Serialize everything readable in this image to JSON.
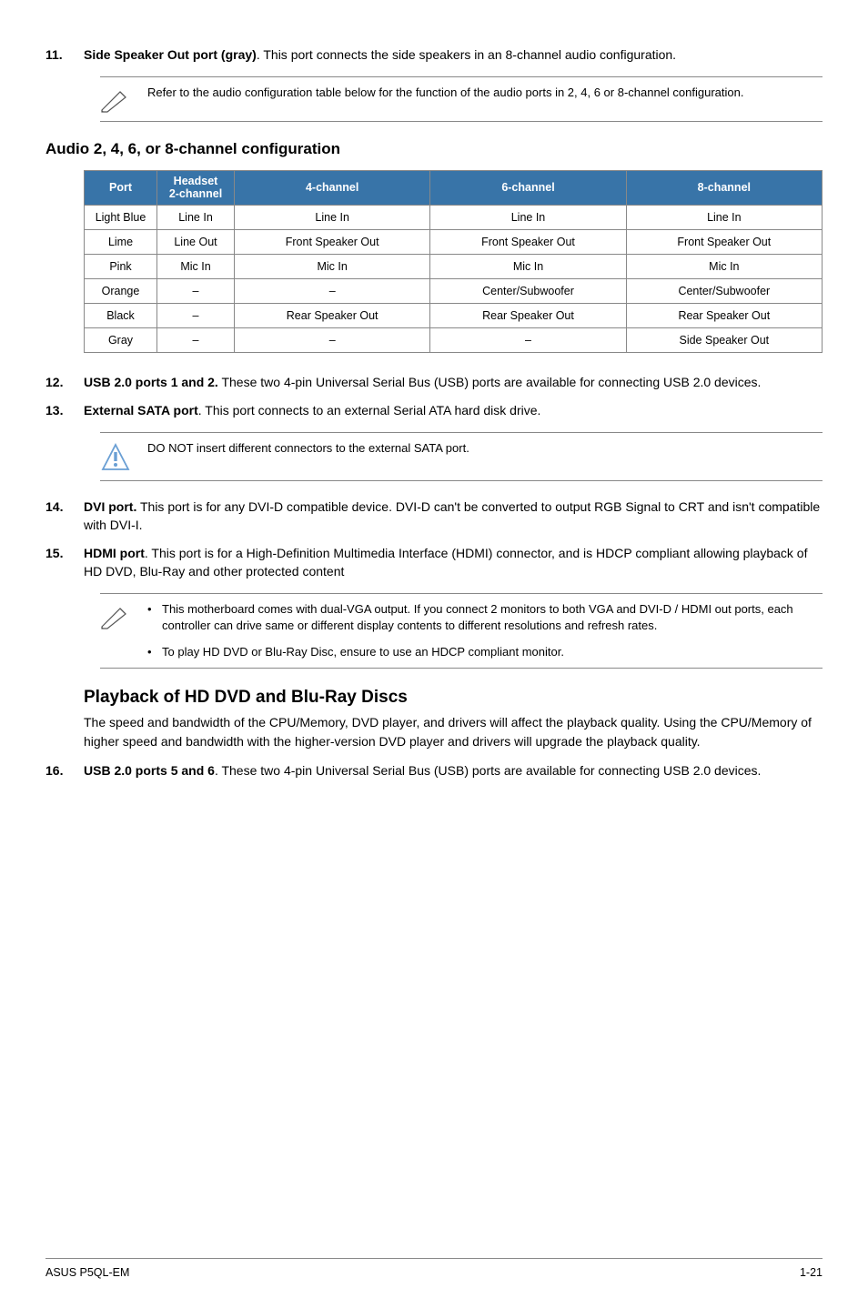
{
  "items": {
    "i11": {
      "num": "11.",
      "title": "Side Speaker Out port (gray)",
      "text": ". This port connects the side speakers in an 8-channel audio configuration."
    },
    "i12": {
      "num": "12.",
      "title": "USB 2.0 ports 1 and 2.",
      "text": " These two 4-pin Universal Serial Bus (USB) ports are available for connecting USB 2.0 devices."
    },
    "i13": {
      "num": "13.",
      "title": "External SATA port",
      "text": ". This port connects to an external Serial ATA hard disk drive."
    },
    "i14": {
      "num": "14.",
      "title": "DVI port.",
      "text": " This port is for any DVI-D compatible device. DVI-D can't be converted to output RGB  Signal to CRT and isn't compatible with DVI-I."
    },
    "i15": {
      "num": "15.",
      "title": "HDMI port",
      "text": ". This port is for a High-Definition Multimedia Interface (HDMI) connector, and is HDCP compliant allowing playback of HD DVD, Blu-Ray and other protected content"
    },
    "i16": {
      "num": "16.",
      "title": "USB 2.0 ports 5 and 6",
      "text": ". These two 4-pin Universal Serial Bus (USB) ports are available for connecting USB 2.0 devices."
    }
  },
  "notes": {
    "n1": "Refer to the audio configuration table below for the function of the audio ports in 2, 4, 6 or 8-channel configuration.",
    "n2": "DO NOT insert different connectors to the external SATA port.",
    "n3a": "This motherboard comes with dual-VGA output. If you connect 2 monitors to both VGA and DVI-D / HDMI out ports, each controller can drive same or different display contents to different resolutions and refresh rates.",
    "n3b": "To play HD DVD or Blu-Ray Disc, ensure to use an HDCP compliant monitor."
  },
  "table_heading": "Audio 2, 4, 6, or 8-channel configuration",
  "table": {
    "headers": {
      "port": "Port",
      "headset_l1": "Headset",
      "headset_l2": "2-channel",
      "c4": "4-channel",
      "c6": "6-channel",
      "c8": "8-channel"
    },
    "rows": [
      {
        "port": "Light Blue",
        "h": "Line In",
        "c4": "Line In",
        "c6": "Line In",
        "c8": "Line In"
      },
      {
        "port": "Lime",
        "h": "Line Out",
        "c4": "Front Speaker Out",
        "c6": "Front Speaker Out",
        "c8": "Front Speaker Out"
      },
      {
        "port": "Pink",
        "h": "Mic In",
        "c4": "Mic In",
        "c6": "Mic In",
        "c8": "Mic In"
      },
      {
        "port": "Orange",
        "h": "–",
        "c4": "–",
        "c6": "Center/Subwoofer",
        "c8": "Center/Subwoofer"
      },
      {
        "port": "Black",
        "h": "–",
        "c4": "Rear Speaker Out",
        "c6": "Rear Speaker Out",
        "c8": "Rear Speaker Out"
      },
      {
        "port": "Gray",
        "h": "–",
        "c4": "–",
        "c6": "–",
        "c8": "Side Speaker Out"
      }
    ]
  },
  "playback": {
    "heading": "Playback of HD DVD and Blu-Ray Discs",
    "body": "The speed and bandwidth of the CPU/Memory, DVD player, and drivers will affect the playback quality. Using the CPU/Memory of higher speed and bandwidth with the higher-version DVD player and drivers will upgrade the playback quality."
  },
  "footer": {
    "left": "ASUS P5QL-EM",
    "right": "1-21"
  }
}
